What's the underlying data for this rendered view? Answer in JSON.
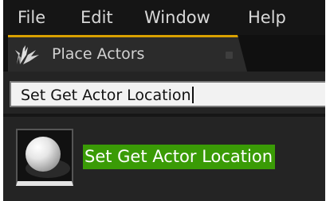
{
  "menu": {
    "file": "File",
    "edit": "Edit",
    "window": "Window",
    "help": "Help"
  },
  "tab": {
    "icon": "place-actors-icon",
    "label": "Place Actors",
    "close_icon": "close-icon",
    "accent_color": "#d9a000"
  },
  "search": {
    "value": "Set Get Actor Location"
  },
  "results": [
    {
      "thumbnail_icon": "sphere-thumbnail-icon",
      "label": "Set Get Actor Location",
      "highlight_color": "#3a9b06"
    }
  ]
}
